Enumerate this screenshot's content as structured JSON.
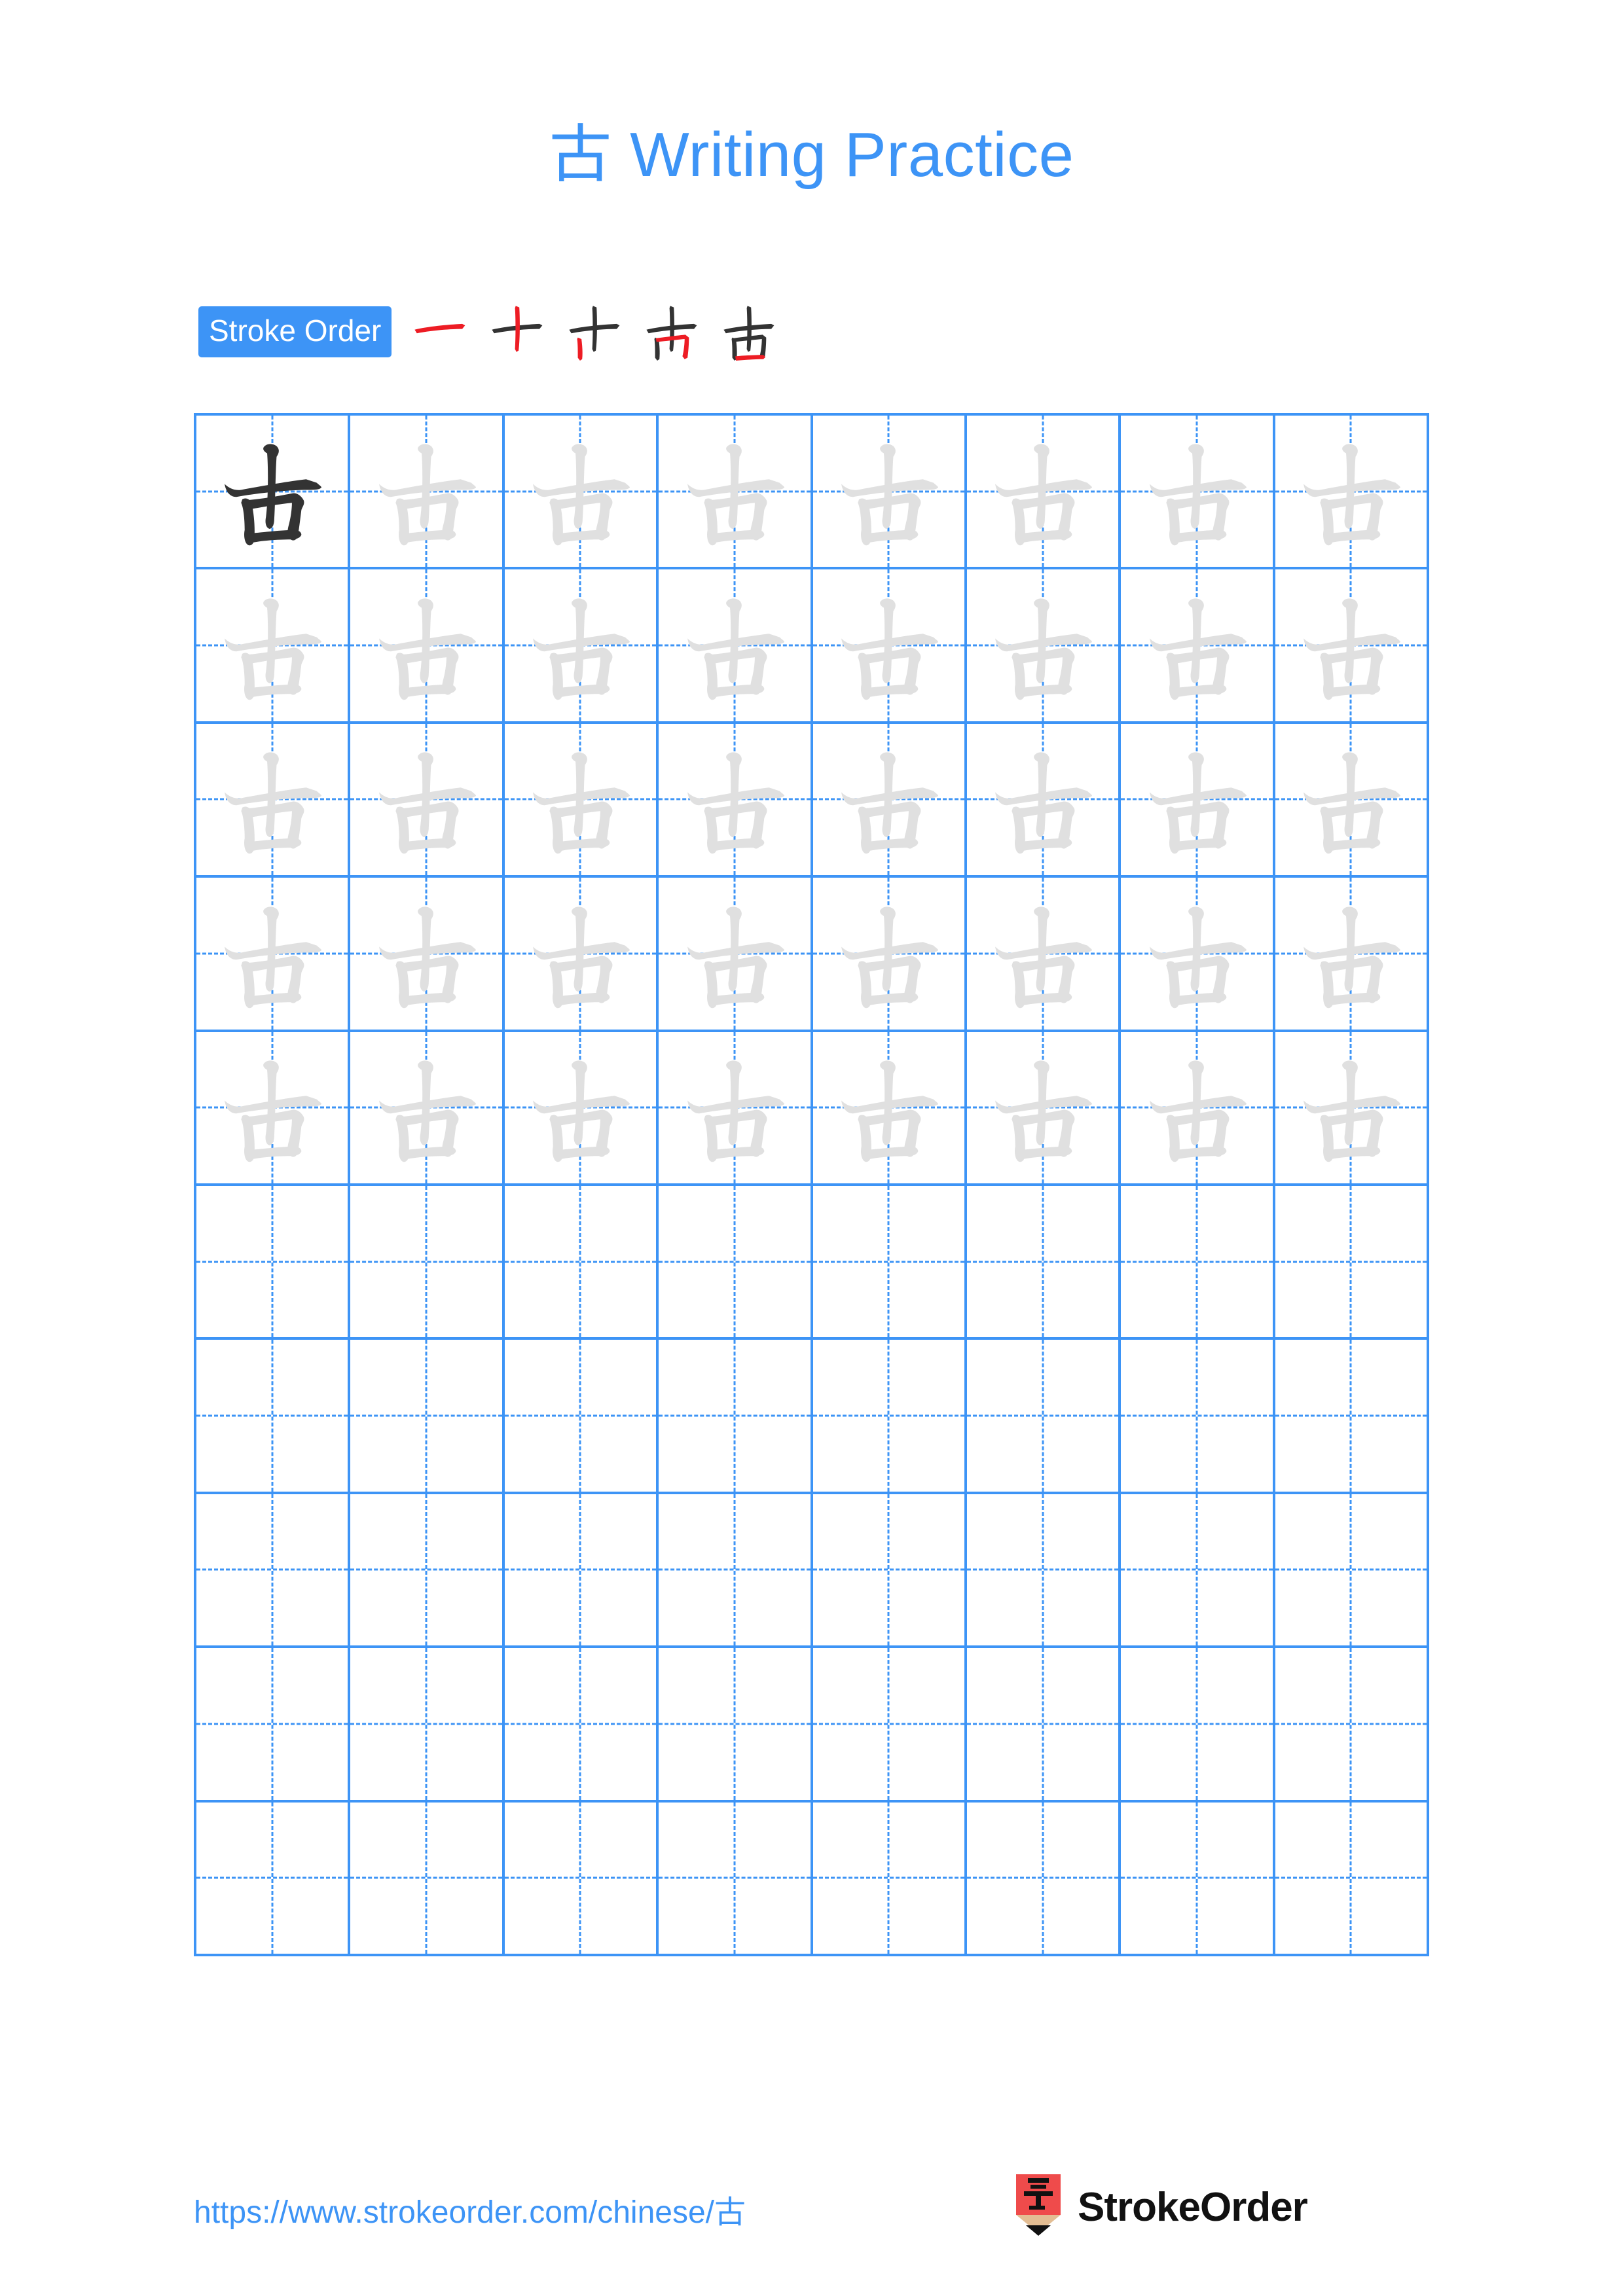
{
  "page": {
    "character": "古",
    "background_color": "#ffffff"
  },
  "header": {
    "title": "古 Writing Practice",
    "title_color": "#3d94f6"
  },
  "stroke_order": {
    "label": "Stroke Order",
    "badge_bg": "#3d94f6",
    "badge_text_color": "#ffffff",
    "new_stroke_color": "#ed1c24",
    "existing_stroke_color": "#333333",
    "step_count": 5,
    "steps": [
      {
        "index": 1,
        "stroke_name": "heng",
        "description": "horizontal stroke"
      },
      {
        "index": 2,
        "stroke_name": "shu",
        "description": "vertical stroke"
      },
      {
        "index": 3,
        "stroke_name": "shu",
        "description": "left vertical of mouth radical"
      },
      {
        "index": 4,
        "stroke_name": "heng-zhe",
        "description": "horizontal turning vertical of mouth radical"
      },
      {
        "index": 5,
        "stroke_name": "heng",
        "description": "bottom horizontal of mouth radical"
      }
    ]
  },
  "grid": {
    "columns": 8,
    "rows": 10,
    "line_color": "#3d94f6",
    "guide_color": "#3d94f6",
    "model_glyph_color": "#333333",
    "trace_glyph_color": "#e0e0e0",
    "filled_rows": 5,
    "empty_rows": 5,
    "cells": [
      [
        "model",
        "trace",
        "trace",
        "trace",
        "trace",
        "trace",
        "trace",
        "trace"
      ],
      [
        "trace",
        "trace",
        "trace",
        "trace",
        "trace",
        "trace",
        "trace",
        "trace"
      ],
      [
        "trace",
        "trace",
        "trace",
        "trace",
        "trace",
        "trace",
        "trace",
        "trace"
      ],
      [
        "trace",
        "trace",
        "trace",
        "trace",
        "trace",
        "trace",
        "trace",
        "trace"
      ],
      [
        "trace",
        "trace",
        "trace",
        "trace",
        "trace",
        "trace",
        "trace",
        "trace"
      ],
      [
        "empty",
        "empty",
        "empty",
        "empty",
        "empty",
        "empty",
        "empty",
        "empty"
      ],
      [
        "empty",
        "empty",
        "empty",
        "empty",
        "empty",
        "empty",
        "empty",
        "empty"
      ],
      [
        "empty",
        "empty",
        "empty",
        "empty",
        "empty",
        "empty",
        "empty",
        "empty"
      ],
      [
        "empty",
        "empty",
        "empty",
        "empty",
        "empty",
        "empty",
        "empty",
        "empty"
      ],
      [
        "empty",
        "empty",
        "empty",
        "empty",
        "empty",
        "empty",
        "empty",
        "empty"
      ]
    ]
  },
  "footer": {
    "url": "https://www.strokeorder.com/chinese/古",
    "url_color": "#3d94f6",
    "brand_name": "StrokeOrder",
    "logo": {
      "icon_name": "pencil-logo",
      "body_color": "#ef4b4b",
      "wood_color": "#e3bd93",
      "tip_color": "#111111",
      "glyph": "字"
    }
  }
}
